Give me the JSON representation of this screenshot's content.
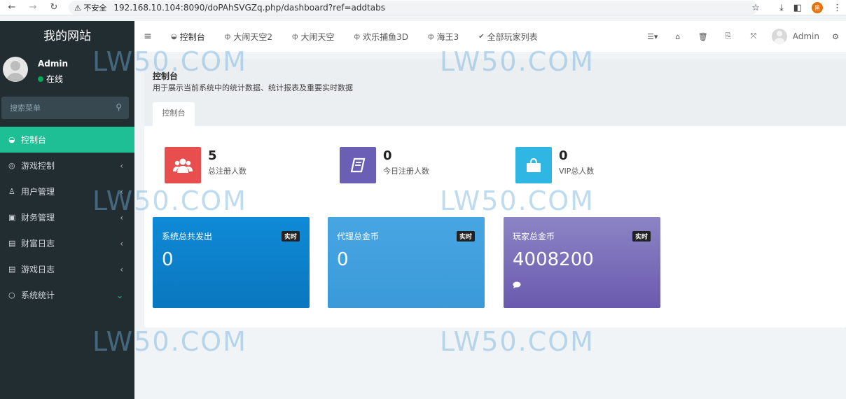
{
  "browser": {
    "security_label": "不安全",
    "url": "192.168.10.104:8090/doPAhSVGZq.php/dashboard?ref=addtabs",
    "profile_initial": "黑"
  },
  "sidebar": {
    "brand": "我的网站",
    "user": {
      "name": "Admin",
      "status": "在线"
    },
    "search_placeholder": "搜索菜单",
    "items": [
      {
        "label": "控制台",
        "icon": "dashboard-icon",
        "active": true
      },
      {
        "label": "游戏控制",
        "icon": "gamepad-icon"
      },
      {
        "label": "用户管理",
        "icon": "user-icon"
      },
      {
        "label": "财务管理",
        "icon": "money-icon"
      },
      {
        "label": "财富日志",
        "icon": "book-icon"
      },
      {
        "label": "游戏日志",
        "icon": "book-icon"
      },
      {
        "label": "系统统计",
        "icon": "circle-icon"
      }
    ]
  },
  "topbar": {
    "tabs": [
      {
        "label": "控制台",
        "icon": "dashboard-icon"
      },
      {
        "label": "大闹天空2",
        "icon": "gamepad-icon"
      },
      {
        "label": "大闹天空",
        "icon": "gamepad-icon"
      },
      {
        "label": "欢乐捕鱼3D",
        "icon": "gamepad-icon"
      },
      {
        "label": "海王3",
        "icon": "gamepad-icon"
      },
      {
        "label": "全部玩家列表",
        "icon": "check-icon"
      }
    ],
    "admin_name": "Admin"
  },
  "header": {
    "title": "控制台",
    "subtitle": "用于展示当前系统中的统计数据、统计报表及重要实时数据",
    "tab": "控制台"
  },
  "stats": [
    {
      "value": "5",
      "label": "总注册人数",
      "color": "#e94e4e",
      "icon": "users-icon"
    },
    {
      "value": "0",
      "label": "今日注册人数",
      "color": "#6b5fb5",
      "icon": "book-icon"
    },
    {
      "value": "0",
      "label": "VIP总人数",
      "color": "#2fb6e3",
      "icon": "shopping-bag-icon"
    }
  ],
  "cards": [
    {
      "title": "系统总共发出",
      "badge": "实时",
      "value": "0",
      "color_top": "#0f8ad6",
      "color_bottom": "#0a77bf"
    },
    {
      "title": "代理总金币",
      "badge": "实时",
      "value": "0",
      "color_top": "#47a6e2",
      "color_bottom": "#3a99d8"
    },
    {
      "title": "玩家总金币",
      "badge": "实时",
      "value": "4008200",
      "color_top": "#8c84c5",
      "color_bottom": "#6a5aae"
    }
  ],
  "watermark": "LW50.COM"
}
